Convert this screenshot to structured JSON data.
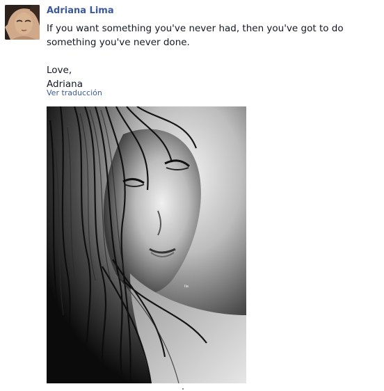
{
  "post": {
    "author_name": "Adriana Lima",
    "message_lines": [
      "If you want something you've never had, then you've got to do",
      "something you've never done.",
      "",
      "Love,",
      "Adriana"
    ],
    "translate_link": "Ver traducción",
    "photo_watermark": "Ila"
  },
  "colors": {
    "link": "#3b5998",
    "text": "#141823",
    "background": "#ffffff"
  },
  "icons": {
    "avatar": "profile-photo",
    "photo": "black-and-white-portrait"
  }
}
